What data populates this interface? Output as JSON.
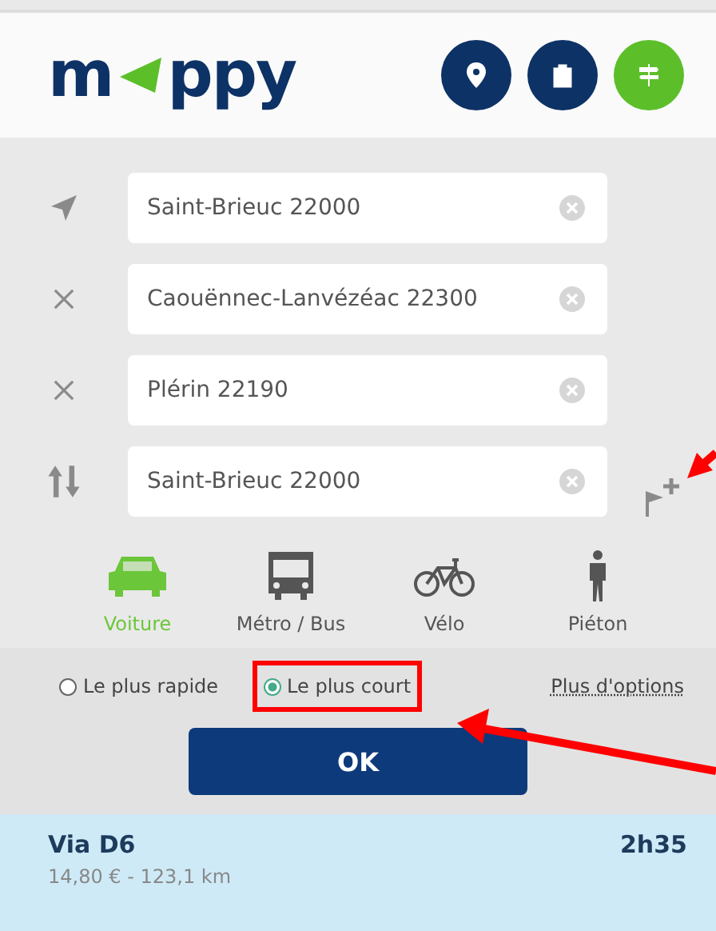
{
  "logo": {
    "left": "m",
    "right": "ppy"
  },
  "header_icons": [
    {
      "kind": "pin",
      "selected": false
    },
    {
      "kind": "bag",
      "selected": false
    },
    {
      "kind": "signpost",
      "selected": true
    }
  ],
  "stops": [
    {
      "kind": "start",
      "value": "Saint-Brieuc 22000"
    },
    {
      "kind": "via",
      "value": "Caouënnec-Lanvézéac 22300"
    },
    {
      "kind": "via",
      "value": "Plérin 22190"
    },
    {
      "kind": "end",
      "value": "Saint-Brieuc 22000"
    }
  ],
  "modes": [
    {
      "kind": "car",
      "label": "Voiture",
      "selected": true
    },
    {
      "kind": "bus",
      "label": "Métro / Bus",
      "selected": false
    },
    {
      "kind": "bike",
      "label": "Vélo",
      "selected": false
    },
    {
      "kind": "walk",
      "label": "Piéton",
      "selected": false
    }
  ],
  "route_options": [
    {
      "label": "Le plus rapide",
      "selected": false,
      "highlighted": false
    },
    {
      "label": "Le plus court",
      "selected": true,
      "highlighted": true
    }
  ],
  "more_options": "Plus d'options",
  "ok_button": "OK",
  "result": {
    "title": "Via D6",
    "duration": "2h35",
    "details": "14,80 € - 123,1 km"
  }
}
